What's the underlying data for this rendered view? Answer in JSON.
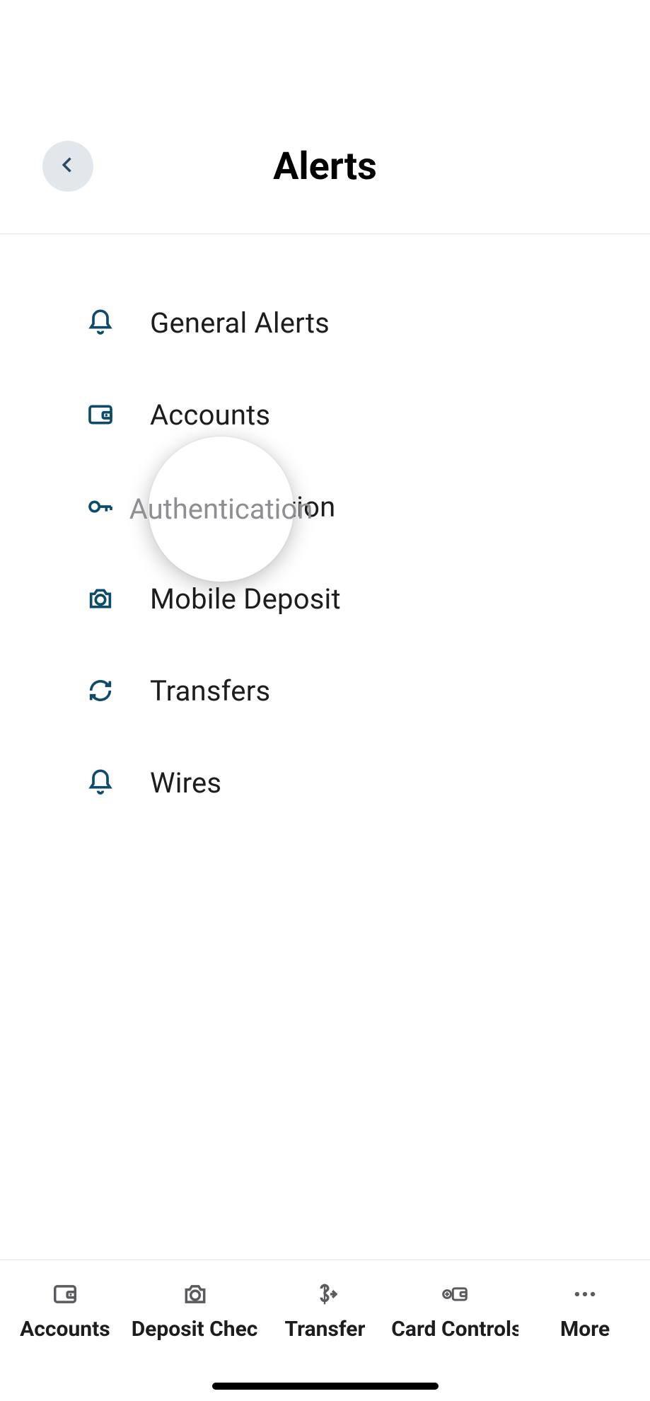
{
  "header": {
    "title": "Alerts"
  },
  "alerts": {
    "items": [
      {
        "icon": "bell",
        "label": "General Alerts"
      },
      {
        "icon": "wallet",
        "label": "Accounts"
      },
      {
        "icon": "key",
        "label": "Authentication"
      },
      {
        "icon": "camera",
        "label": "Mobile Deposit"
      },
      {
        "icon": "refresh",
        "label": "Transfers"
      },
      {
        "icon": "bell",
        "label": "Wires"
      }
    ]
  },
  "highlight": {
    "label": "Authentication"
  },
  "tabbar": {
    "items": [
      {
        "icon": "wallet",
        "label": "Accounts"
      },
      {
        "icon": "camera",
        "label": "Deposit Check"
      },
      {
        "icon": "dollar",
        "label": "Transfer"
      },
      {
        "icon": "card-plus",
        "label": "Card Controls"
      },
      {
        "icon": "dots",
        "label": "More"
      }
    ]
  }
}
